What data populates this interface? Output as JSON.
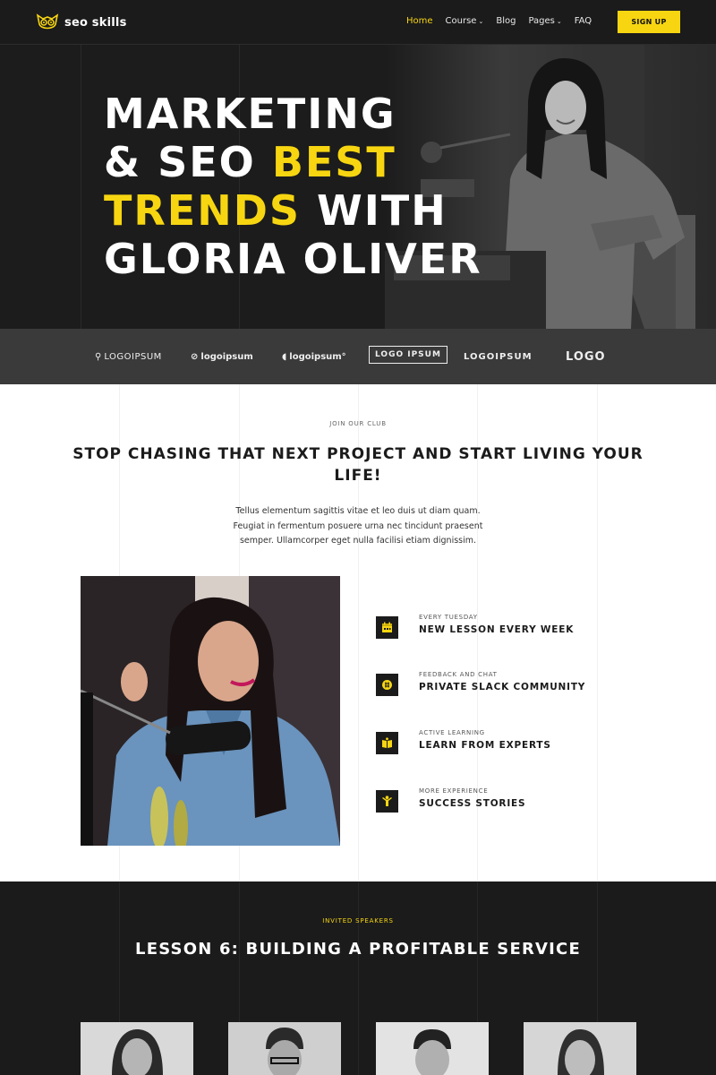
{
  "brand": {
    "name": "seo skills",
    "accent": "#f7d611",
    "dark": "#1b1b1b"
  },
  "nav": {
    "items": [
      {
        "label": "Home",
        "active": true,
        "dropdown": false
      },
      {
        "label": "Course",
        "active": false,
        "dropdown": true
      },
      {
        "label": "Blog",
        "active": false,
        "dropdown": false
      },
      {
        "label": "Pages",
        "active": false,
        "dropdown": true
      },
      {
        "label": "FAQ",
        "active": false,
        "dropdown": false
      }
    ],
    "signup_label": "SIGN UP"
  },
  "hero": {
    "line1": "MARKETING",
    "line2_white": "& SEO ",
    "line2_yellow": "BEST",
    "line3_yellow": "TRENDS",
    "line3_white": " WITH",
    "line4": "GLORIA OLIVER"
  },
  "partner_logos": [
    "LOGOIPSUM",
    "logoipsum",
    "logoipsum°",
    "LOGO IPSUM",
    "LOGOIPSUM",
    "LOGO"
  ],
  "club": {
    "eyebrow": "JOIN OUR CLUB",
    "title": "STOP CHASING THAT NEXT PROJECT AND START LIVING YOUR LIFE!",
    "description": "Tellus elementum sagittis vitae et leo duis ut diam quam. Feugiat in fermentum posuere urna nec tincidunt praesent semper. Ullamcorper eget nulla facilisi etiam dignissim.",
    "features": [
      {
        "sub": "EVERY TUESDAY",
        "title": "NEW LESSON EVERY WEEK",
        "icon": "calendar-icon"
      },
      {
        "sub": "FEEDBACK AND CHAT",
        "title": "PRIVATE SLACK COMMUNITY",
        "icon": "slack-icon"
      },
      {
        "sub": "ACTIVE LEARNING",
        "title": "LEARN FROM EXPERTS",
        "icon": "book-icon"
      },
      {
        "sub": "MORE EXPERIENCE",
        "title": "SUCCESS STORIES",
        "icon": "trophy-person-icon"
      }
    ]
  },
  "speakers": {
    "eyebrow": "INVITED SPEAKERS",
    "title": "LESSON 6: BUILDING A PROFITABLE SERVICE"
  }
}
